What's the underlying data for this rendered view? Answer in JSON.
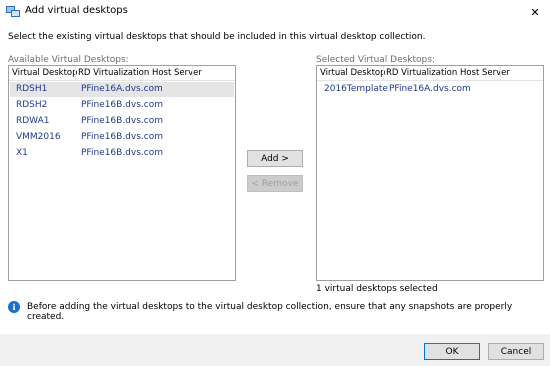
{
  "window": {
    "title": "Add virtual desktops",
    "close_glyph": "✕"
  },
  "instruction": "Select the existing virtual desktops that should be included in this virtual desktop collection.",
  "available": {
    "label": "Available Virtual Desktops:",
    "columns": [
      "Virtual Desktop",
      "RD Virtualization Host Server"
    ],
    "rows": [
      {
        "desktop": "RDSH1",
        "host": "PFine16A.dvs.com",
        "selected": true
      },
      {
        "desktop": "RDSH2",
        "host": "PFine16B.dvs.com",
        "selected": false
      },
      {
        "desktop": "RDWA1",
        "host": "PFine16B.dvs.com",
        "selected": false
      },
      {
        "desktop": "VMM2016",
        "host": "PFine16B.dvs.com",
        "selected": false
      },
      {
        "desktop": "X1",
        "host": "PFine16B.dvs.com",
        "selected": false
      }
    ]
  },
  "selected": {
    "label": "Selected Virtual Desktops:",
    "columns": [
      "Virtual Desktop",
      "RD Virtualization Host Server"
    ],
    "rows": [
      {
        "desktop": "2016Template",
        "host": "PFine16A.dvs.com"
      }
    ],
    "count_text": "1 virtual desktops selected"
  },
  "buttons": {
    "add": "Add >",
    "remove": "< Remove",
    "ok": "OK",
    "cancel": "Cancel"
  },
  "info": {
    "icon": "info-icon",
    "text": "Before adding the virtual desktops to the virtual desktop collection, ensure that any snapshots are properly created."
  },
  "colors": {
    "link_text": "#1f3a93",
    "info_blue": "#1e6fc8",
    "footer_bg": "#f0f0f0",
    "selection_bg": "#e5e5e5"
  }
}
